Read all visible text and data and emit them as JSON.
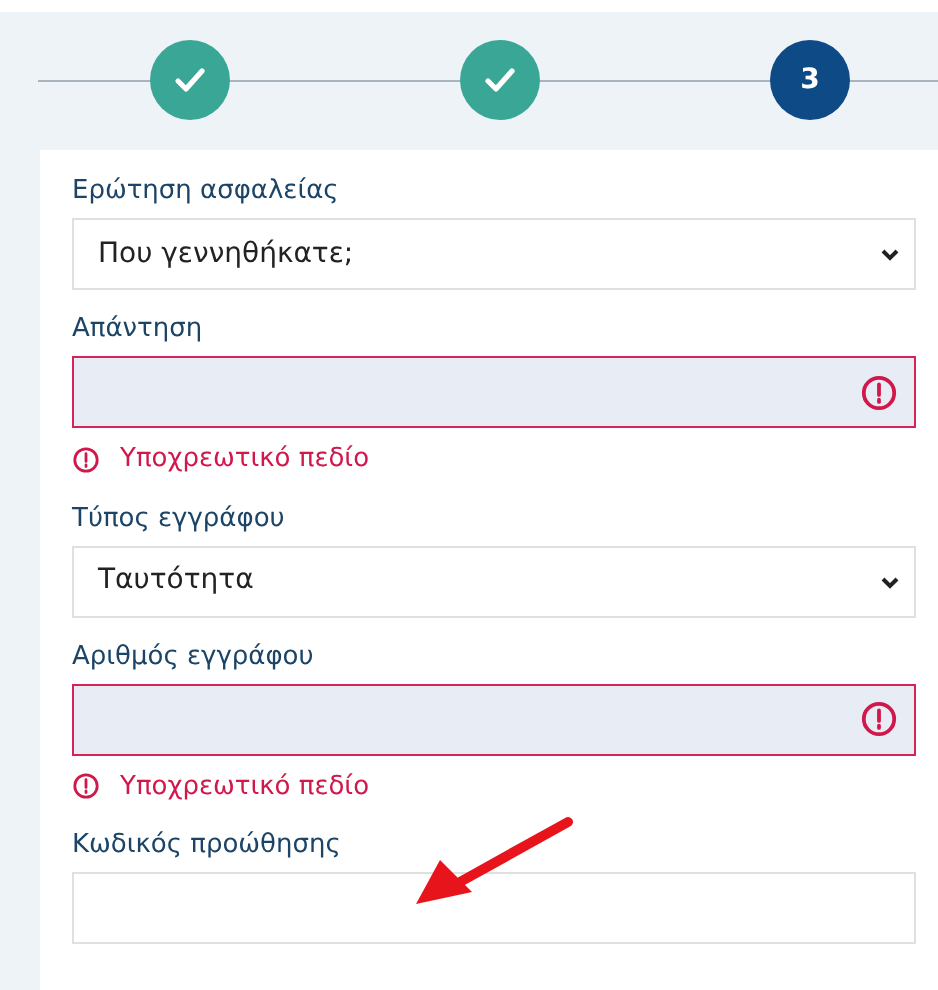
{
  "steps": [
    {
      "completed": true
    },
    {
      "completed": true
    },
    {
      "completed": false,
      "number": "3"
    }
  ],
  "fields": [
    {
      "kind": "select",
      "label": "Ερώτηση ασφαλείας",
      "value": "Που γεννηθήκατε;"
    },
    {
      "kind": "text",
      "label": "Απάντηση",
      "invalid": true,
      "error": "Υποχρεωτικό πεδίο"
    },
    {
      "kind": "select",
      "label": "Τύπος εγγράφου",
      "value": "Ταυτότητα"
    },
    {
      "kind": "text",
      "label": "Αριθμός εγγράφου",
      "invalid": true,
      "error": "Υποχρεωτικό πεδίο"
    },
    {
      "kind": "text",
      "label": "Κωδικός προώθησης",
      "invalid": false
    }
  ],
  "annotation": {
    "kind": "arrow"
  }
}
